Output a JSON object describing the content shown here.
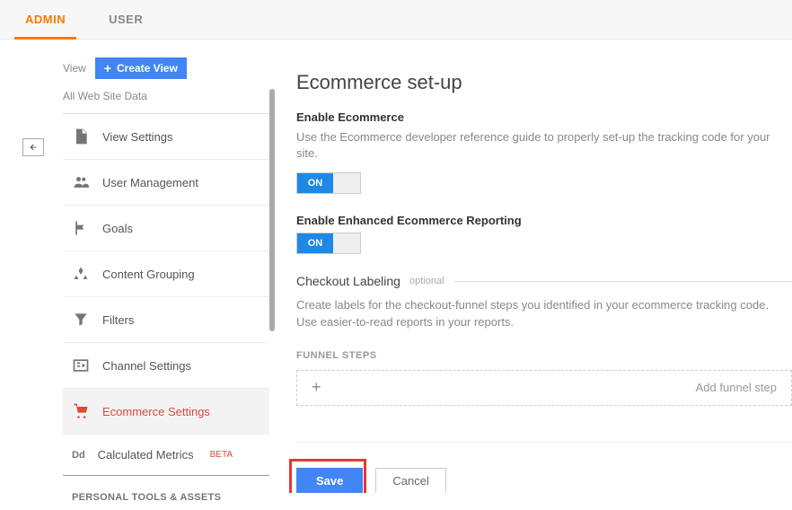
{
  "tabs": {
    "admin": "ADMIN",
    "user": "USER"
  },
  "sidebar": {
    "view_label": "View",
    "create_view": "Create View",
    "all_data": "All Web Site Data",
    "items": [
      "View Settings",
      "User Management",
      "Goals",
      "Content Grouping",
      "Filters",
      "Channel Settings",
      "Ecommerce Settings",
      "Calculated Metrics"
    ],
    "beta": "BETA",
    "section_head": "PERSONAL TOOLS & ASSETS"
  },
  "main": {
    "title": "Ecommerce set-up",
    "enable_head": "Enable Ecommerce",
    "enable_desc": "Use the Ecommerce developer reference guide to properly set-up the tracking code for your site.",
    "enhanced_head": "Enable Enhanced Ecommerce Reporting",
    "toggle_on": "ON",
    "checkout_label": "Checkout Labeling",
    "optional": "optional",
    "checkout_desc": "Create labels for the checkout-funnel steps you identified in your ecommerce tracking code. Use easier-to-read reports in your reports.",
    "funnel_head": "FUNNEL STEPS",
    "funnel_placeholder": "Add funnel step",
    "save": "Save",
    "cancel": "Cancel"
  }
}
